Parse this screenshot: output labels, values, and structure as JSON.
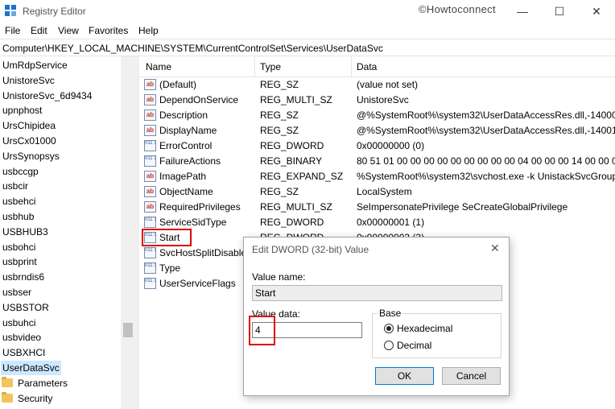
{
  "window": {
    "title": "Registry Editor",
    "watermark": "©Howtoconnect",
    "minimize_glyph": "—",
    "maximize_glyph": "☐",
    "close_glyph": "✕"
  },
  "menu": {
    "file": "File",
    "edit": "Edit",
    "view": "View",
    "favorites": "Favorites",
    "help": "Help"
  },
  "address": {
    "path": "Computer\\HKEY_LOCAL_MACHINE\\SYSTEM\\CurrentControlSet\\Services\\UserDataSvc"
  },
  "tree": {
    "items": [
      "UmRdpService",
      "UnistoreSvc",
      "UnistoreSvc_6d9434",
      "upnphost",
      "UrsChipidea",
      "UrsCx01000",
      "UrsSynopsys",
      "usbccgp",
      "usbcir",
      "usbehci",
      "usbhub",
      "USBHUB3",
      "usbohci",
      "usbprint",
      "usbrndis6",
      "usbser",
      "USBSTOR",
      "usbuhci",
      "usbvideo",
      "USBXHCI",
      "UserDataSvc"
    ],
    "children": [
      "Parameters",
      "Security"
    ]
  },
  "list": {
    "headers": {
      "name": "Name",
      "type": "Type",
      "data": "Data"
    },
    "rows": [
      {
        "name": "(Default)",
        "type": "REG_SZ",
        "data": "(value not set)",
        "icon": "string-value-icon"
      },
      {
        "name": "DependOnService",
        "type": "REG_MULTI_SZ",
        "data": "UnistoreSvc",
        "icon": "string-value-icon"
      },
      {
        "name": "Description",
        "type": "REG_SZ",
        "data": "@%SystemRoot%\\system32\\UserDataAccessRes.dll,-14000",
        "icon": "string-value-icon"
      },
      {
        "name": "DisplayName",
        "type": "REG_SZ",
        "data": "@%SystemRoot%\\system32\\UserDataAccessRes.dll,-14001",
        "icon": "string-value-icon"
      },
      {
        "name": "ErrorControl",
        "type": "REG_DWORD",
        "data": "0x00000000 (0)",
        "icon": "binary-value-icon"
      },
      {
        "name": "FailureActions",
        "type": "REG_BINARY",
        "data": "80 51 01 00 00 00 00 00 00 00 00 00 04 00 00 00 14 00 00 00 01 0",
        "icon": "binary-value-icon"
      },
      {
        "name": "ImagePath",
        "type": "REG_EXPAND_SZ",
        "data": "%SystemRoot%\\system32\\svchost.exe -k UnistackSvcGroup",
        "icon": "string-value-icon"
      },
      {
        "name": "ObjectName",
        "type": "REG_SZ",
        "data": "LocalSystem",
        "icon": "string-value-icon"
      },
      {
        "name": "RequiredPrivileges",
        "type": "REG_MULTI_SZ",
        "data": "SeImpersonatePrivilege SeCreateGlobalPrivilege",
        "icon": "string-value-icon"
      },
      {
        "name": "ServiceSidType",
        "type": "REG_DWORD",
        "data": "0x00000001 (1)",
        "icon": "binary-value-icon"
      },
      {
        "name": "Start",
        "type": "REG_DWORD",
        "data": "0x00000003 (3)",
        "icon": "binary-value-icon"
      },
      {
        "name": "SvcHostSplitDisable",
        "type": "",
        "data": "",
        "icon": "binary-value-icon"
      },
      {
        "name": "Type",
        "type": "",
        "data": "",
        "icon": "binary-value-icon"
      },
      {
        "name": "UserServiceFlags",
        "type": "",
        "data": "",
        "icon": "binary-value-icon"
      }
    ]
  },
  "dialog": {
    "title": "Edit DWORD (32-bit) Value",
    "close_glyph": "✕",
    "value_name_label": "Value name:",
    "value_name": "Start",
    "value_data_label": "Value data:",
    "value_data": "4",
    "base_label": "Base",
    "hex_label": "Hexadecimal",
    "dec_label": "Decimal",
    "base_selected": "Hexadecimal",
    "ok_label": "OK",
    "cancel_label": "Cancel"
  },
  "colors": {
    "highlight_red": "#e00000",
    "selection_blue": "#cce8ff",
    "ok_border": "#0078d7"
  }
}
